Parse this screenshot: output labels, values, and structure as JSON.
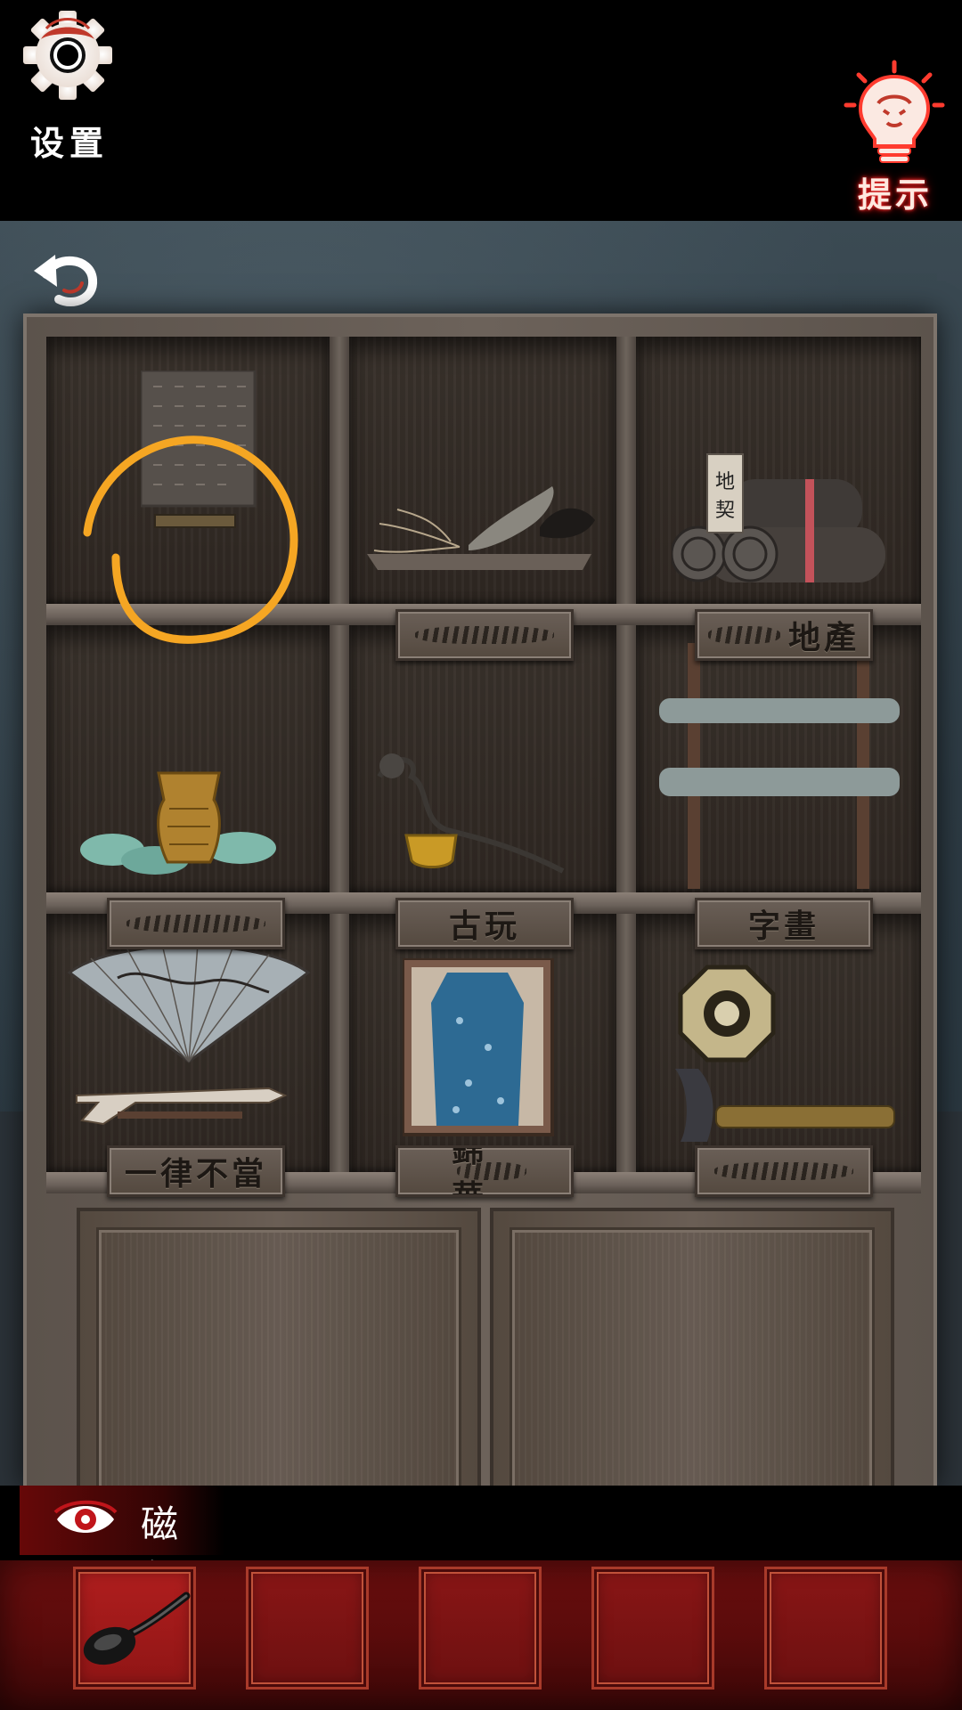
{
  "top_bar": {
    "settings_label": "设置",
    "settings_icon": "gear-icon",
    "hint_label": "提示",
    "hint_icon": "lightbulb-icon"
  },
  "navigation": {
    "back_icon": "back-arrow-icon"
  },
  "cabinet": {
    "shelves": [
      {
        "row": 1,
        "cells": [
          {
            "item": "stone-tablet-inscription",
            "plaque": ""
          },
          {
            "item": "ginseng-and-fungus-tray",
            "plaque": ""
          },
          {
            "item": "land-deed-scrolls",
            "plaque": "地產",
            "item_label": "地契"
          }
        ]
      },
      {
        "row": 2,
        "cells": [
          {
            "item": "bronze-cup-and-jade-coins",
            "plaque": ""
          },
          {
            "item": "incense-cup-and-branch",
            "plaque": "古玩"
          },
          {
            "item": "hanging-scrolls",
            "plaque": "字畫"
          }
        ]
      },
      {
        "row": 3,
        "cells": [
          {
            "item": "fan-and-pistol",
            "plaque": "一律不當"
          },
          {
            "item": "framed-qipao",
            "plaque": "錦華"
          },
          {
            "item": "bagua-mirror-and-telescope",
            "plaque": ""
          }
        ]
      }
    ],
    "annotation_color": "#f5a623"
  },
  "item_bar": {
    "eye_icon": "eye-icon",
    "current_item_name": "磁勺"
  },
  "inventory": {
    "slots": [
      {
        "item": "magnetic-spoon",
        "selected": true
      },
      {
        "item": null,
        "selected": false
      },
      {
        "item": null,
        "selected": false
      },
      {
        "item": null,
        "selected": false
      },
      {
        "item": null,
        "selected": false
      }
    ]
  },
  "colors": {
    "accent_red": "#8a1616",
    "annotation_orange": "#f5a623"
  }
}
